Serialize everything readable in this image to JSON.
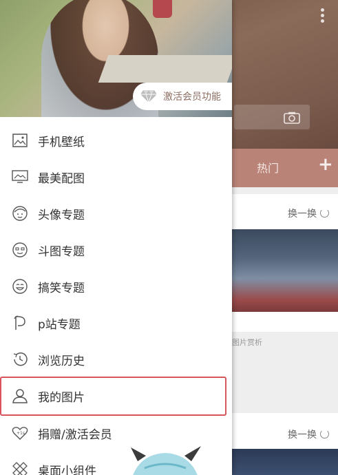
{
  "background_app": {
    "tab_hot": "热门",
    "plus_label": "+",
    "swap_label": "换一换",
    "caption": "图片赏析"
  },
  "drawer": {
    "activate_member": "激活会员功能",
    "items": [
      {
        "label": "手机壁纸",
        "icon": "wallpaper-icon"
      },
      {
        "label": "最美配图",
        "icon": "monitor-icon"
      },
      {
        "label": "头像专题",
        "icon": "avatar-face-icon"
      },
      {
        "label": "斗图专题",
        "icon": "meme-face-icon"
      },
      {
        "label": "搞笑专题",
        "icon": "laugh-face-icon"
      },
      {
        "label": "p站专题",
        "icon": "pixiv-icon"
      },
      {
        "label": "浏览历史",
        "icon": "history-icon"
      },
      {
        "label": "我的图片",
        "icon": "user-icon"
      },
      {
        "label": "捐赠/激活会员",
        "icon": "heart-plus-icon"
      },
      {
        "label": "桌面小组件",
        "icon": "widget-icon"
      }
    ],
    "selected_item": "我的图片"
  },
  "colors": {
    "accent_tab": "#b98378",
    "highlight_border": "#d9535a",
    "pill_text": "#8d6e63"
  }
}
